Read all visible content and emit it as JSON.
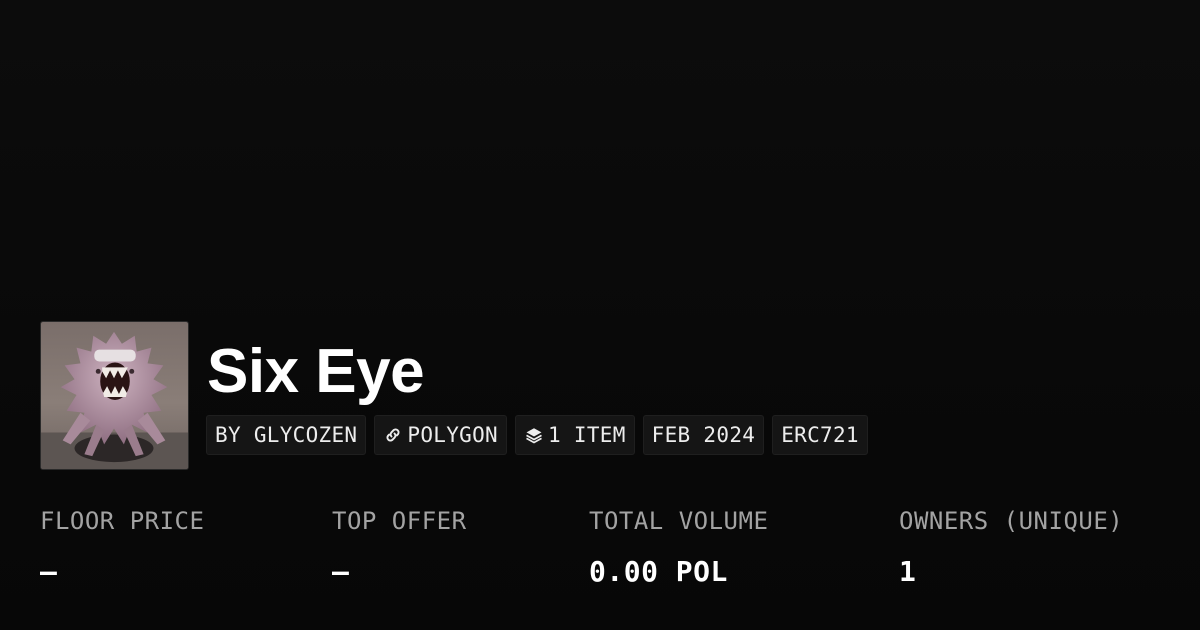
{
  "collection": {
    "title": "Six Eye",
    "thumbnail_alt": "collection-artwork",
    "creator": "BY GLYCOZEN",
    "chain": "POLYGON",
    "item_count": "1 ITEM",
    "created": "FEB 2024",
    "standard": "ERC721"
  },
  "stats": [
    {
      "label": "FLOOR PRICE",
      "value": "—"
    },
    {
      "label": "TOP OFFER",
      "value": "—"
    },
    {
      "label": "TOTAL VOLUME",
      "value": "0.00 POL"
    },
    {
      "label": "OWNERS (UNIQUE)",
      "value": "1"
    }
  ],
  "icons": {
    "chain": "link-icon",
    "items": "layers-icon"
  },
  "colors": {
    "background": "#0a0a0a",
    "chip_background": "#151515",
    "label_gray": "#a3a3a3",
    "text_white": "#ffffff"
  }
}
